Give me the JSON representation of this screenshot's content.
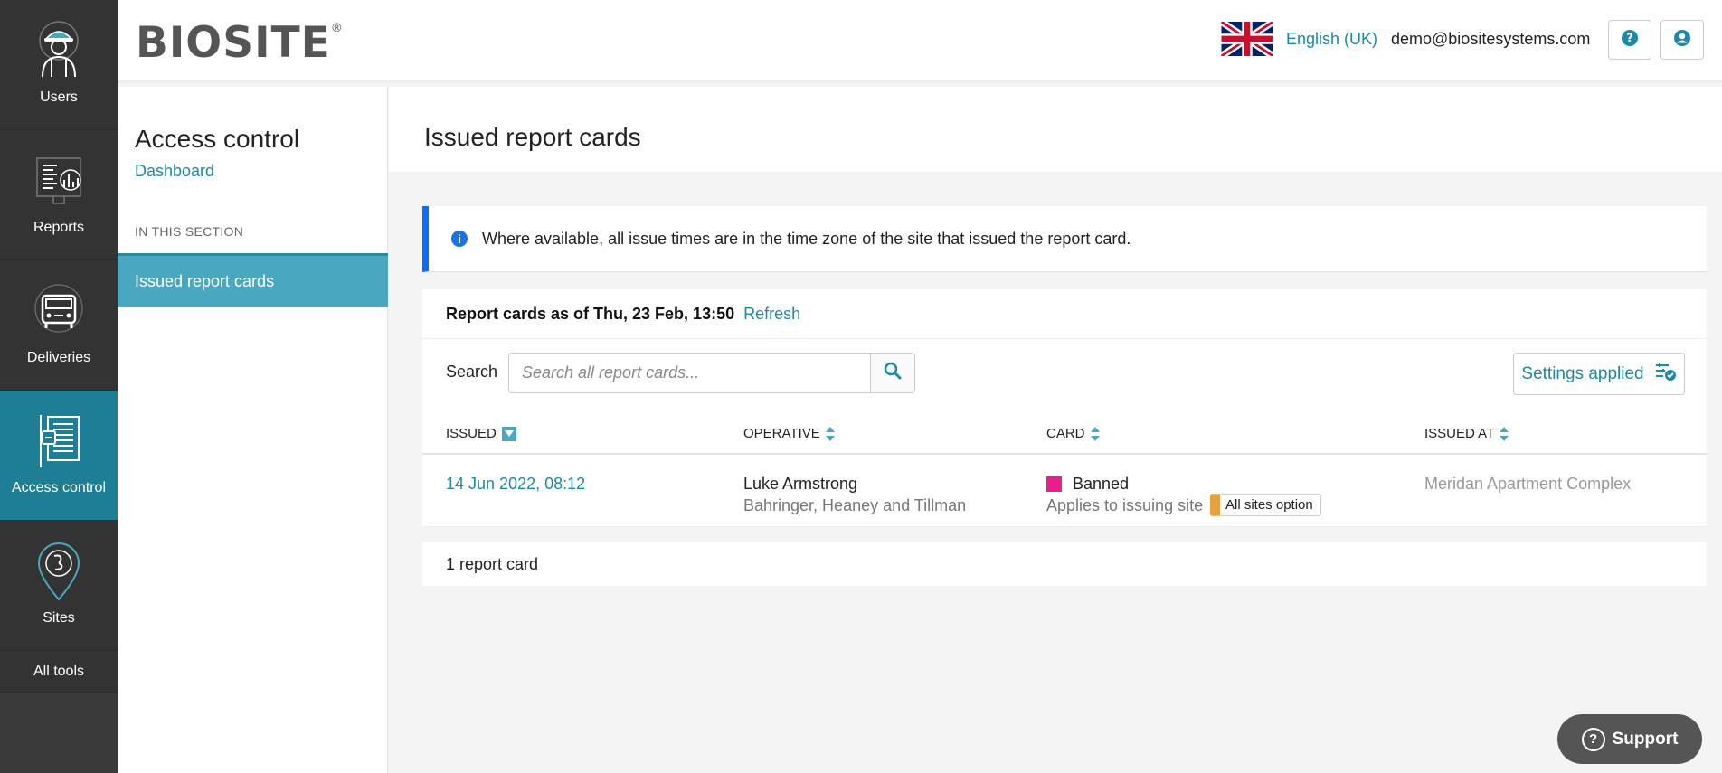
{
  "nav": {
    "items": [
      {
        "label": "Users",
        "icon": "worker-icon"
      },
      {
        "label": "Reports",
        "icon": "reports-icon"
      },
      {
        "label": "Deliveries",
        "icon": "truck-icon"
      },
      {
        "label": "Access control",
        "icon": "access-control-icon"
      },
      {
        "label": "Sites",
        "icon": "map-pin-icon"
      }
    ],
    "all_tools": "All tools",
    "active": "Access control"
  },
  "header": {
    "logo_text": "BIOSITE",
    "logo_mark": "®",
    "language": "English (UK)",
    "email": "demo@biositesystems.com",
    "help_icon": "question-icon",
    "account_icon": "user-icon"
  },
  "section": {
    "title": "Access control",
    "dashboard_link": "Dashboard",
    "in_this_section": "IN THIS SECTION",
    "active_item": "Issued report cards"
  },
  "page": {
    "title": "Issued report cards",
    "info_text": "Where available, all issue times are in the time zone of the site that issued the report card.",
    "as_of": "Report cards as of Thu, 23 Feb, 13:50",
    "refresh": "Refresh",
    "search_label": "Search",
    "search_placeholder": "Search all report cards...",
    "settings_label": "Settings applied",
    "columns": {
      "issued": "Issued",
      "operative": "Operative",
      "card": "Card",
      "issued_at": "Issued at"
    },
    "rows": [
      {
        "issued": "14 Jun 2022, 08:12",
        "operative_name": "Luke Armstrong",
        "operative_company": "Bahringer, Heaney and Tillman",
        "card_name": "Banned",
        "card_color": "#e91e8c",
        "card_applies": "Applies to issuing site",
        "card_badge": "All sites option",
        "issued_at": "Meridan Apartment Complex"
      }
    ],
    "count_text": "1 report card"
  },
  "support": {
    "label": "Support"
  },
  "colors": {
    "accent": "#1e88a8",
    "active_nav": "#1e7e95",
    "info_border": "#0d6efd",
    "badge": "#e6a23c"
  }
}
